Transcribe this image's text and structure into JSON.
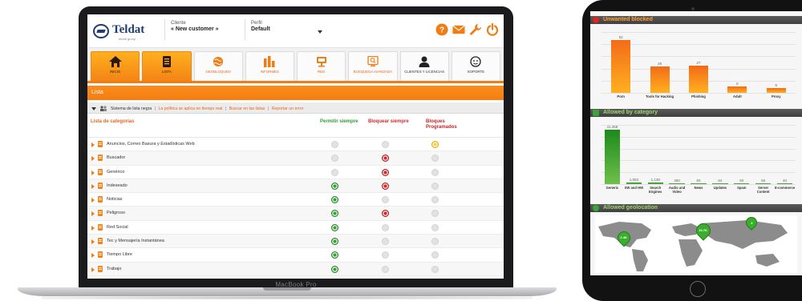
{
  "device": {
    "laptop_brand": "MacBook Pro"
  },
  "header": {
    "logo_text": "Teldat",
    "logo_tagline": "teldat group",
    "client_label": "Cliente",
    "client_value": "« New customer »",
    "profile_label": "Perfil",
    "profile_value": "Default",
    "icons": [
      "help-icon",
      "mail-icon",
      "wrench-icon",
      "power-icon"
    ],
    "accent": "#f07c14"
  },
  "nav": {
    "tabs": [
      {
        "label": "INICIO",
        "icon": "home-icon",
        "active": true
      },
      {
        "label": "LISTA",
        "icon": "list-icon",
        "active": true
      },
      {
        "label": "GEOBLOQUEO",
        "icon": "geo-icon",
        "active": false
      },
      {
        "label": "INFORMES",
        "icon": "reports-icon",
        "active": false
      },
      {
        "label": "RED",
        "icon": "network-icon",
        "active": false
      },
      {
        "label": "BÚSQUEDA AVANZADA",
        "icon": "search-icon",
        "active": false
      },
      {
        "label": "CLIENTES Y LICENCIAS",
        "icon": "user-icon",
        "active": false
      },
      {
        "label": "SOPORTE",
        "icon": "support-icon",
        "active": false
      }
    ]
  },
  "section_title": "Lista",
  "breadcrumb": {
    "main": "Sistema de lista negra",
    "links": [
      "La política se aplica en tiempo real",
      "Buscar en las listas",
      "Reportar un error"
    ]
  },
  "table": {
    "headers": {
      "category": "Lista de categorías",
      "allow": "Permitir siempre",
      "block": "Bloquear siempre",
      "scheduled": "Bloques Programados"
    },
    "rows": [
      {
        "name": "Anuncios, Correo Basura y Estadísticas Web",
        "allow": "off",
        "block": "off",
        "scheduled": "yellow"
      },
      {
        "name": "Buscador",
        "allow": "off",
        "block": "red",
        "scheduled": "off"
      },
      {
        "name": "Genérico",
        "allow": "off",
        "block": "red",
        "scheduled": "off"
      },
      {
        "name": "Indeseado",
        "allow": "green",
        "block": "red",
        "scheduled": "off"
      },
      {
        "name": "Noticias",
        "allow": "green",
        "block": "off",
        "scheduled": "off"
      },
      {
        "name": "Peligroso",
        "allow": "green",
        "block": "red",
        "scheduled": "off"
      },
      {
        "name": "Red Social",
        "allow": "green",
        "block": "off",
        "scheduled": "off"
      },
      {
        "name": "Tec y Mensajería Instantánea",
        "allow": "green",
        "block": "off",
        "scheduled": "off"
      },
      {
        "name": "Tiempo Libre",
        "allow": "green",
        "block": "off",
        "scheduled": "off"
      },
      {
        "name": "Trabajo",
        "allow": "green",
        "block": "off",
        "scheduled": "off"
      }
    ]
  },
  "tablet": {
    "unwanted_title": "Unwanted blocked",
    "allowed_title": "Allowed by category",
    "geo_title": "Allowed geolocation",
    "geo_pins": [
      {
        "label": "2.4K"
      },
      {
        "label": "16.7K"
      },
      {
        "label": "4"
      }
    ]
  },
  "chart_data": [
    {
      "type": "bar",
      "title": "Unwanted blocked",
      "categories": [
        "Porn",
        "Tools for Hacking",
        "Phishing",
        "Adult",
        "Proxy"
      ],
      "values": [
        52,
        26,
        27,
        6,
        5
      ],
      "ylim": [
        0,
        60
      ],
      "colors": [
        "#f36b17",
        "#ffb020"
      ]
    },
    {
      "type": "bar",
      "title": "Allowed by category",
      "categories": [
        "Generic",
        "SW and HW",
        "Search Engines",
        "Audio and Video",
        "News",
        "Updates",
        "Spam",
        "Server Content",
        "E-commerce"
      ],
      "values": [
        41458,
        1083,
        1138,
        360,
        83,
        64,
        50,
        55,
        40
      ],
      "value_labels": [
        "41,458",
        "1,083",
        "1,138",
        "360",
        "83",
        "64",
        "50",
        "55",
        "40"
      ],
      "ylim": [
        0,
        45000
      ],
      "colors": [
        "#1c8a1c",
        "#6fc04a"
      ]
    }
  ]
}
